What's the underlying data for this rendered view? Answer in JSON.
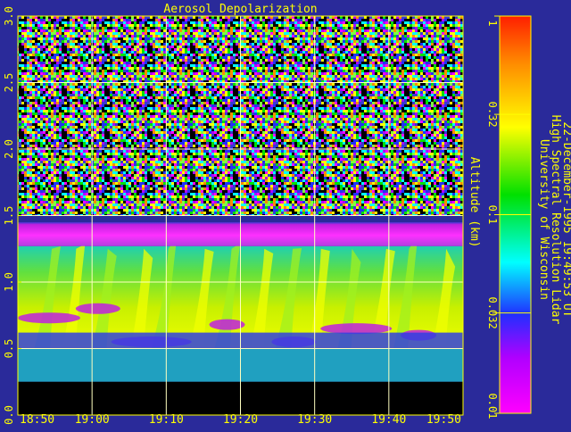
{
  "chart_data": {
    "type": "heatmap",
    "title": "Aerosol Depolarization",
    "ylabel": "Altitude (km)",
    "xlabel": "",
    "x_ticks": [
      "18:50",
      "19:00",
      "19:10",
      "19:20",
      "19:30",
      "19:40",
      "19:50"
    ],
    "y_ticks": [
      "0.0",
      "0.5",
      "1.0",
      "1.5",
      "2.0",
      "2.5",
      "3.0"
    ],
    "ylim": [
      0.0,
      3.0
    ],
    "xlim": [
      "18:50",
      "19:50"
    ],
    "grid": true,
    "colorbar": {
      "scale": "log",
      "range": [
        0.01,
        1
      ],
      "tick_labels": [
        "1",
        "0.32",
        "0.1",
        "0.032",
        "0.01"
      ],
      "colors": [
        "#ff1f00",
        "#ff8c00",
        "#ffff00",
        "#00e000",
        "#00ffff",
        "#2030ff",
        "#b000ff",
        "#ff00ff"
      ]
    },
    "features": [
      {
        "description": "no data (below instrument range)",
        "altitude_km": [
          0.0,
          0.25
        ],
        "color": "#000000"
      },
      {
        "description": "noise region",
        "altitude_km": [
          1.5,
          3.0
        ]
      },
      {
        "description": "high depolarization layer",
        "altitude_km": [
          1.27,
          1.45
        ],
        "color": "#d020d0"
      },
      {
        "description": "aerosol/ice layer",
        "altitude_km": [
          0.5,
          1.27
        ],
        "color": "#d8f000"
      }
    ],
    "side_text": [
      "University of Wisconsin",
      "High Spectral Resolution Lidar",
      "22-December-1995 19:49:53 UT"
    ]
  },
  "colors": {
    "background": "#2a2a9a",
    "axis": "#ffff00",
    "grid": "#ffffc0",
    "text": "#ffff00"
  }
}
